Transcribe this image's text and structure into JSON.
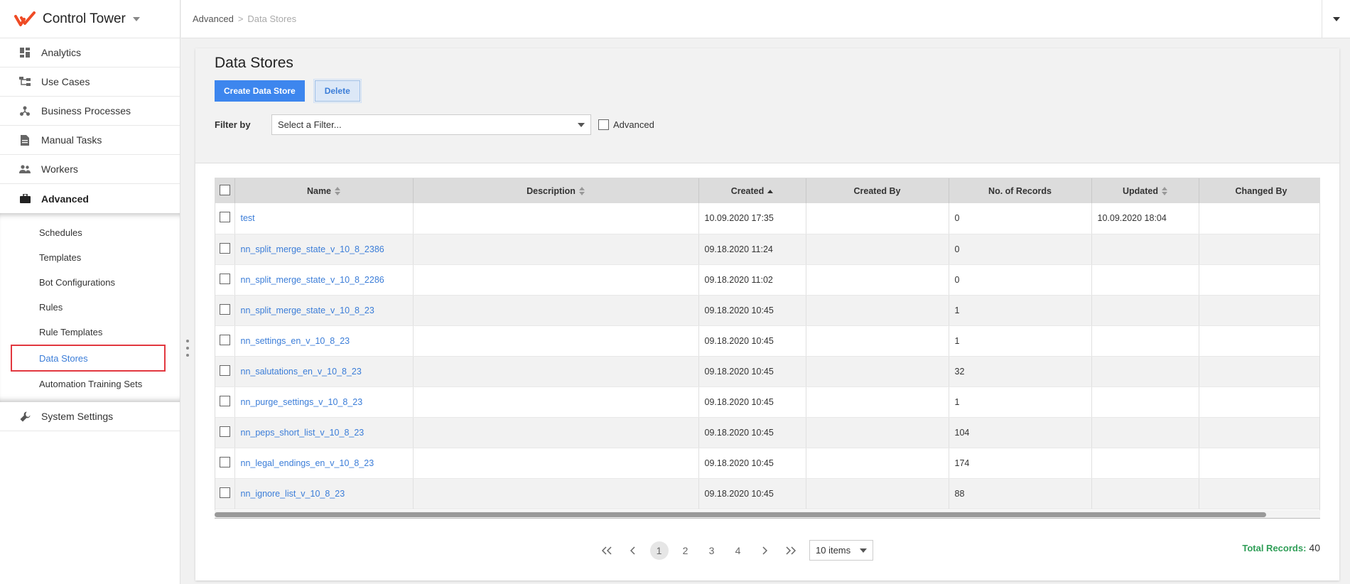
{
  "app": {
    "title": "Control Tower"
  },
  "sidebar": {
    "items": [
      {
        "label": "Analytics",
        "icon": "dashboard-icon"
      },
      {
        "label": "Use Cases",
        "icon": "hierarchy-icon"
      },
      {
        "label": "Business Processes",
        "icon": "process-icon"
      },
      {
        "label": "Manual Tasks",
        "icon": "document-icon"
      },
      {
        "label": "Workers",
        "icon": "people-icon"
      },
      {
        "label": "Advanced",
        "icon": "briefcase-icon"
      }
    ],
    "sub_items": [
      "Schedules",
      "Templates",
      "Bot Configurations",
      "Rules",
      "Rule Templates",
      "Data Stores",
      "Automation Training Sets"
    ],
    "bottom_item": {
      "label": "System Settings",
      "icon": "wrench-icon"
    }
  },
  "breadcrumb": {
    "parent": "Advanced",
    "sep": ">",
    "current": "Data Stores"
  },
  "page": {
    "title": "Data Stores",
    "create_label": "Create Data Store",
    "delete_label": "Delete",
    "filter_label": "Filter by",
    "filter_placeholder": "Select a Filter...",
    "advanced_label": "Advanced"
  },
  "table": {
    "columns": [
      "Name",
      "Description",
      "Created",
      "Created By",
      "No. of Records",
      "Updated",
      "Changed By"
    ],
    "rows": [
      {
        "name": "test",
        "description": "",
        "created": "10.09.2020 17:35",
        "created_by": "",
        "records": "0",
        "updated": "10.09.2020 18:04",
        "changed_by": ""
      },
      {
        "name": "nn_split_merge_state_v_10_8_2386",
        "description": "",
        "created": "09.18.2020 11:24",
        "created_by": "",
        "records": "0",
        "updated": "",
        "changed_by": ""
      },
      {
        "name": "nn_split_merge_state_v_10_8_2286",
        "description": "",
        "created": "09.18.2020 11:02",
        "created_by": "",
        "records": "0",
        "updated": "",
        "changed_by": ""
      },
      {
        "name": "nn_split_merge_state_v_10_8_23",
        "description": "",
        "created": "09.18.2020 10:45",
        "created_by": "",
        "records": "1",
        "updated": "",
        "changed_by": ""
      },
      {
        "name": "nn_settings_en_v_10_8_23",
        "description": "",
        "created": "09.18.2020 10:45",
        "created_by": "",
        "records": "1",
        "updated": "",
        "changed_by": ""
      },
      {
        "name": "nn_salutations_en_v_10_8_23",
        "description": "",
        "created": "09.18.2020 10:45",
        "created_by": "",
        "records": "32",
        "updated": "",
        "changed_by": ""
      },
      {
        "name": "nn_purge_settings_v_10_8_23",
        "description": "",
        "created": "09.18.2020 10:45",
        "created_by": "",
        "records": "1",
        "updated": "",
        "changed_by": ""
      },
      {
        "name": "nn_peps_short_list_v_10_8_23",
        "description": "",
        "created": "09.18.2020 10:45",
        "created_by": "",
        "records": "104",
        "updated": "",
        "changed_by": ""
      },
      {
        "name": "nn_legal_endings_en_v_10_8_23",
        "description": "",
        "created": "09.18.2020 10:45",
        "created_by": "",
        "records": "174",
        "updated": "",
        "changed_by": ""
      },
      {
        "name": "nn_ignore_list_v_10_8_23",
        "description": "",
        "created": "09.18.2020 10:45",
        "created_by": "",
        "records": "88",
        "updated": "",
        "changed_by": ""
      }
    ]
  },
  "pager": {
    "pages": [
      "1",
      "2",
      "3",
      "4"
    ],
    "current": "1",
    "page_size": "10 items",
    "total_label": "Total Records:",
    "total_value": "40"
  },
  "colors": {
    "accent": "#3d86ee",
    "link": "#3b7dd8",
    "total": "#2f9e57",
    "highlight": "#e2383f"
  }
}
